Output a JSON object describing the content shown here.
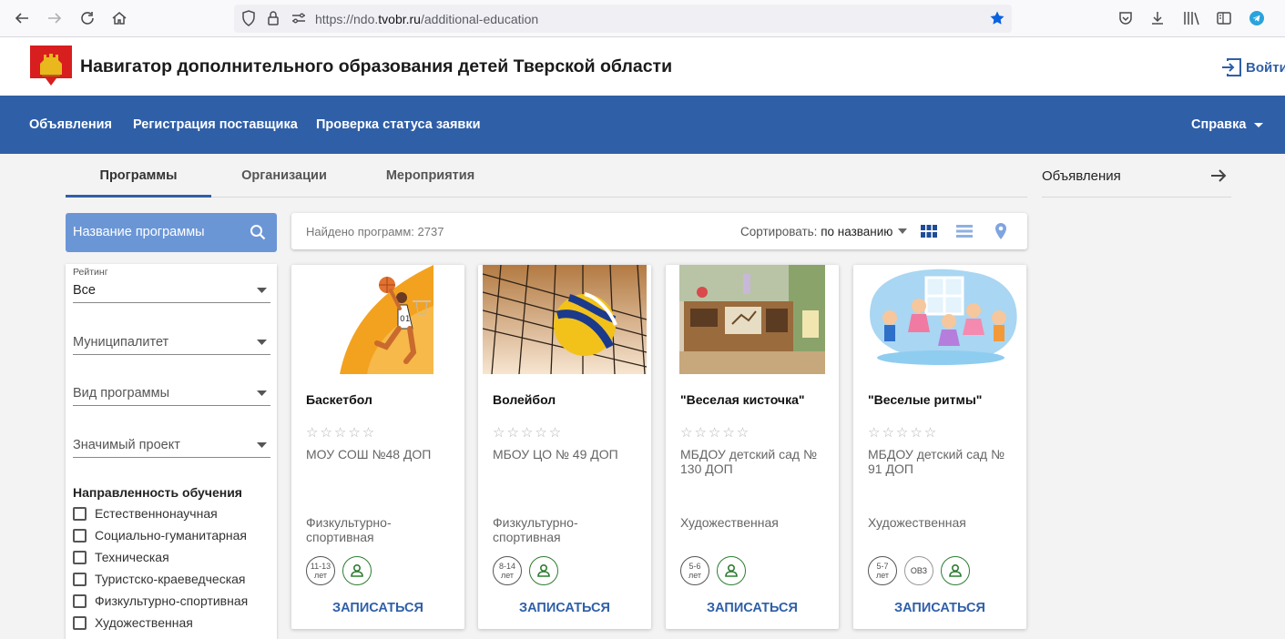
{
  "browser": {
    "url_prefix": "https://ndo.",
    "url_domain": "tvobr.ru",
    "url_path": "/additional-education"
  },
  "header": {
    "title": "Навигатор дополнительного образования детей Тверской области",
    "login_label": "Войти"
  },
  "nav": {
    "items": [
      "Объявления",
      "Регистрация поставщика",
      "Проверка статуса заявки"
    ],
    "help_label": "Справка"
  },
  "tabs": [
    "Программы",
    "Организации",
    "Мероприятия"
  ],
  "announcements": {
    "title": "Объявления"
  },
  "search": {
    "placeholder": "Название программы"
  },
  "results": {
    "found": "Найдено программ: 2737",
    "sort_label": "Сортировать:",
    "sort_value": "по названию"
  },
  "filters": {
    "rating_label": "Рейтинг",
    "rating_value": "Все",
    "municipality": "Муниципалитет",
    "program_type": "Вид программы",
    "project": "Значимый проект",
    "direction_title": "Направленность обучения",
    "directions": [
      "Естественнонаучная",
      "Социально-гуманитарная",
      "Техническая",
      "Туристско-краеведческая",
      "Физкультурно-спортивная",
      "Художественная"
    ]
  },
  "cards": [
    {
      "title": "Баскетбол",
      "stars": "☆☆☆☆☆",
      "org": "МОУ СОШ №48 ДОП",
      "direction": "Физкультурно-спортивная",
      "age_top": "11-13",
      "age_bottom": "лет",
      "ovz": "",
      "button": "ЗАПИСАТЬСЯ"
    },
    {
      "title": "Волейбол",
      "stars": "☆☆☆☆☆",
      "org": "МБОУ ЦО № 49 ДОП",
      "direction": "Физкультурно-спортивная",
      "age_top": "8-14",
      "age_bottom": "лет",
      "ovz": "",
      "button": "ЗАПИСАТЬСЯ"
    },
    {
      "title": "\"Веселая кисточка\"",
      "stars": "☆☆☆☆☆",
      "org": "МБДОУ детский сад № 130 ДОП",
      "direction": "Художественная",
      "age_top": "5-6",
      "age_bottom": "лет",
      "ovz": "",
      "button": "ЗАПИСАТЬСЯ"
    },
    {
      "title": "\"Веселые ритмы\"",
      "stars": "☆☆☆☆☆",
      "org": "МБДОУ детский сад № 91 ДОП",
      "direction": "Художественная",
      "age_top": "5-7",
      "age_bottom": "лет",
      "ovz": "ОВЗ",
      "button": "ЗАПИСАТЬСЯ"
    }
  ],
  "colors": {
    "primary": "#2f5fa7",
    "search_bg": "#6b96d6"
  }
}
